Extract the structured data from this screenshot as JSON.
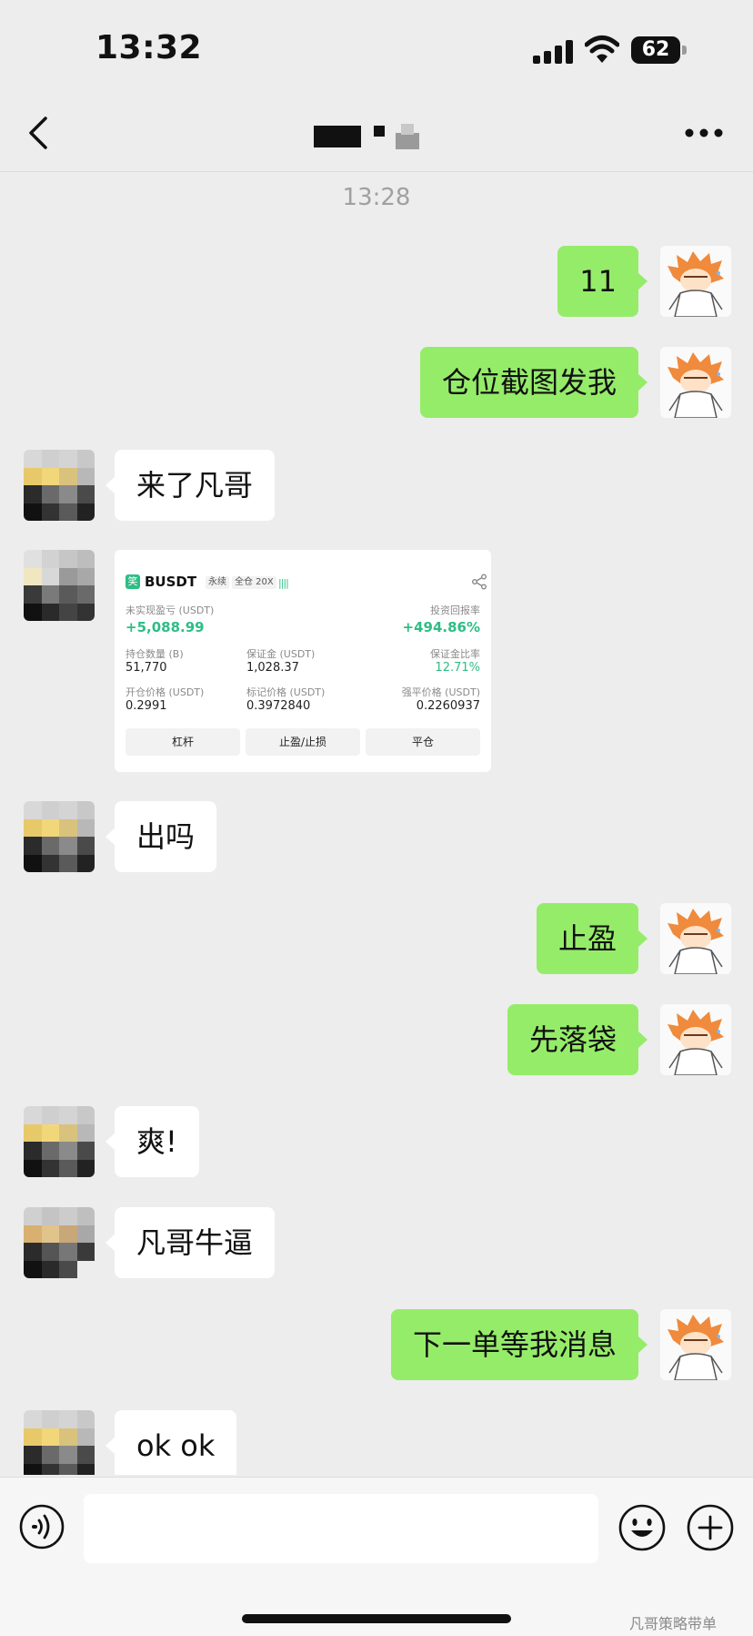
{
  "status_bar": {
    "time": "13:32",
    "battery": "62"
  },
  "nav": {
    "title": ""
  },
  "chat": {
    "timestamp": "13:28",
    "messages": [
      {
        "from": "me",
        "text": "11"
      },
      {
        "from": "me",
        "text": "仓位截图发我"
      },
      {
        "from": "other",
        "text": "来了凡哥"
      },
      {
        "from": "other",
        "type": "image"
      },
      {
        "from": "other",
        "text": "出吗"
      },
      {
        "from": "me",
        "text": "止盈"
      },
      {
        "from": "me",
        "text": "先落袋"
      },
      {
        "from": "other",
        "text": "爽!"
      },
      {
        "from": "other",
        "text": "凡哥牛逼"
      },
      {
        "from": "me",
        "text": "下一单等我消息"
      },
      {
        "from": "other",
        "text": "ok ok"
      }
    ]
  },
  "position_card": {
    "symbol": "BUSDT",
    "tag_perpetual": "永续",
    "tag_margin": "全仓 20X",
    "unrealized_pnl_label": "未实现盈亏 (USDT)",
    "unrealized_pnl_value": "+5,088.99",
    "roi_label": "投资回报率",
    "roi_value": "+494.86%",
    "size_label": "持仓数量 (B)",
    "size_value": "51,770",
    "margin_label": "保证金 (USDT)",
    "margin_value": "1,028.37",
    "margin_ratio_label": "保证金比率",
    "margin_ratio_value": "12.71%",
    "entry_label": "开仓价格 (USDT)",
    "entry_value": "0.2991",
    "mark_label": "标记价格 (USDT)",
    "mark_value": "0.3972840",
    "liq_label": "强平价格 (USDT)",
    "liq_value": "0.2260937",
    "btn_leverage": "杠杆",
    "btn_tpsl": "止盈/止损",
    "btn_close": "平仓"
  },
  "input_bar": {
    "placeholder": ""
  },
  "watermark": "凡哥策略带单",
  "colors": {
    "me_bubble": "#95ec69",
    "other_bubble": "#ffffff",
    "background": "#ededed",
    "profit_green": "#2ebd85"
  }
}
